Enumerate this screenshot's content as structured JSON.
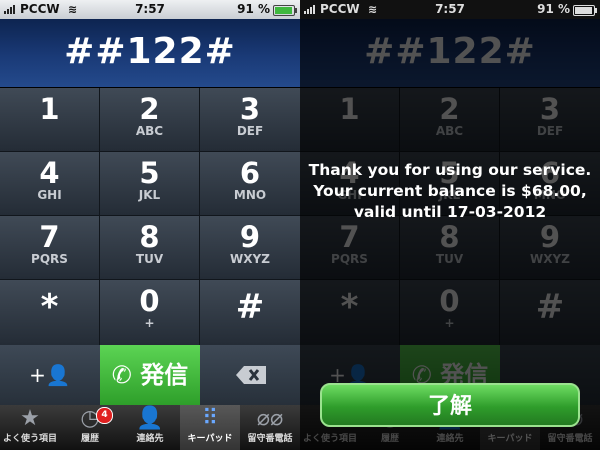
{
  "status": {
    "carrier": "PCCW",
    "time": "7:57",
    "battery": "91 %"
  },
  "dialed_number": "##122#",
  "keys": [
    {
      "digit": "1",
      "letters": ""
    },
    {
      "digit": "2",
      "letters": "ABC"
    },
    {
      "digit": "3",
      "letters": "DEF"
    },
    {
      "digit": "4",
      "letters": "GHI"
    },
    {
      "digit": "5",
      "letters": "JKL"
    },
    {
      "digit": "6",
      "letters": "MNO"
    },
    {
      "digit": "7",
      "letters": "PQRS"
    },
    {
      "digit": "8",
      "letters": "TUV"
    },
    {
      "digit": "9",
      "letters": "WXYZ"
    },
    {
      "digit": "*",
      "letters": ""
    },
    {
      "digit": "0",
      "letters": "+"
    },
    {
      "digit": "#",
      "letters": ""
    }
  ],
  "actions": {
    "add_contact_icon": "+👤",
    "call_label": "発信",
    "call_icon": "phone-icon"
  },
  "tabs": [
    {
      "label": "よく使う項目",
      "icon": "star-icon"
    },
    {
      "label": "履歴",
      "icon": "clock-icon",
      "badge": "4"
    },
    {
      "label": "連絡先",
      "icon": "person-icon"
    },
    {
      "label": "キーパッド",
      "icon": "keypad-icon"
    },
    {
      "label": "留守番電話",
      "icon": "voicemail-icon"
    }
  ],
  "alert": {
    "line1": "Thank you for using our service.",
    "line2": "Your current balance is $68.00,",
    "line3": "valid until 17-03-2012",
    "ok_label": "了解"
  },
  "colors": {
    "call_green": "#2e9f2a",
    "display_blue": "#1a3a77",
    "badge_red": "#e02020"
  }
}
